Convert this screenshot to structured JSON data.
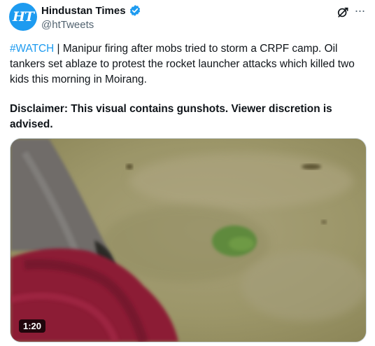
{
  "account": {
    "display_name": "Hindustan Times",
    "handle": "@htTweets",
    "avatar_text": "HT",
    "verified": true
  },
  "tweet": {
    "hashtag": "#WATCH",
    "body": " | Manipur firing after mobs tried to storm a CRPF camp. Oil tankers set ablaze to protest the rocket launcher attacks which killed two kids this morning in Moirang.",
    "disclaimer": "Disclaimer: This visual contains gunshots. Viewer discretion is advised."
  },
  "media": {
    "type": "video",
    "duration": "1:20"
  },
  "icons": {
    "grok": "grok-icon",
    "more": "more-icon",
    "verified": "verified-badge-icon"
  },
  "colors": {
    "accent": "#1d9bf0",
    "text": "#0f1419",
    "secondary": "#536471"
  }
}
